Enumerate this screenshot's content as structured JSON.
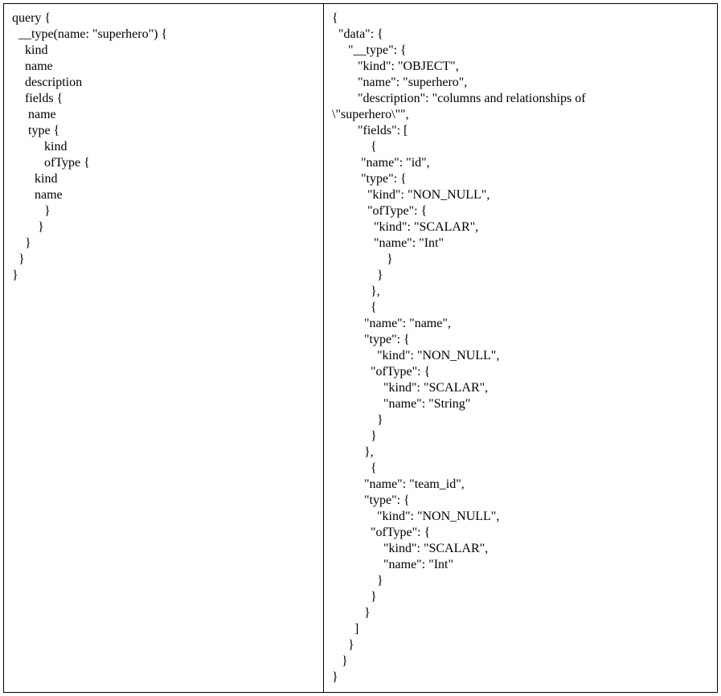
{
  "query": {
    "lines": [
      "query {",
      "  __type(name: \"superhero\") {",
      "    kind",
      "    name",
      "    description",
      "    fields {",
      "     name",
      "     type {",
      "          kind",
      "          ofType {",
      "       kind",
      "       name",
      "          }",
      "        }",
      "    }",
      "  }",
      "}"
    ]
  },
  "response": {
    "lines": [
      "{",
      "  \"data\": {",
      "     \"__type\": {",
      "        \"kind\": \"OBJECT\",",
      "        \"name\": \"superhero\",",
      "        \"description\": \"columns and relationships of",
      "\\\"superhero\\\"\",",
      "        \"fields\": [",
      "            {",
      "         \"name\": \"id\",",
      "         \"type\": {",
      "           \"kind\": \"NON_NULL\",",
      "           \"ofType\": {",
      "             \"kind\": \"SCALAR\",",
      "             \"name\": \"Int\"",
      "                 }",
      "              }",
      "            },",
      "            {",
      "          \"name\": \"name\",",
      "          \"type\": {",
      "              \"kind\": \"NON_NULL\",",
      "            \"ofType\": {",
      "                \"kind\": \"SCALAR\",",
      "                \"name\": \"String\"",
      "              }",
      "            }",
      "          },",
      "            {",
      "          \"name\": \"team_id\",",
      "          \"type\": {",
      "              \"kind\": \"NON_NULL\",",
      "            \"ofType\": {",
      "                \"kind\": \"SCALAR\",",
      "                \"name\": \"Int\"",
      "              }",
      "            }",
      "          }",
      "       ]",
      "     }",
      "   }",
      "}"
    ]
  }
}
